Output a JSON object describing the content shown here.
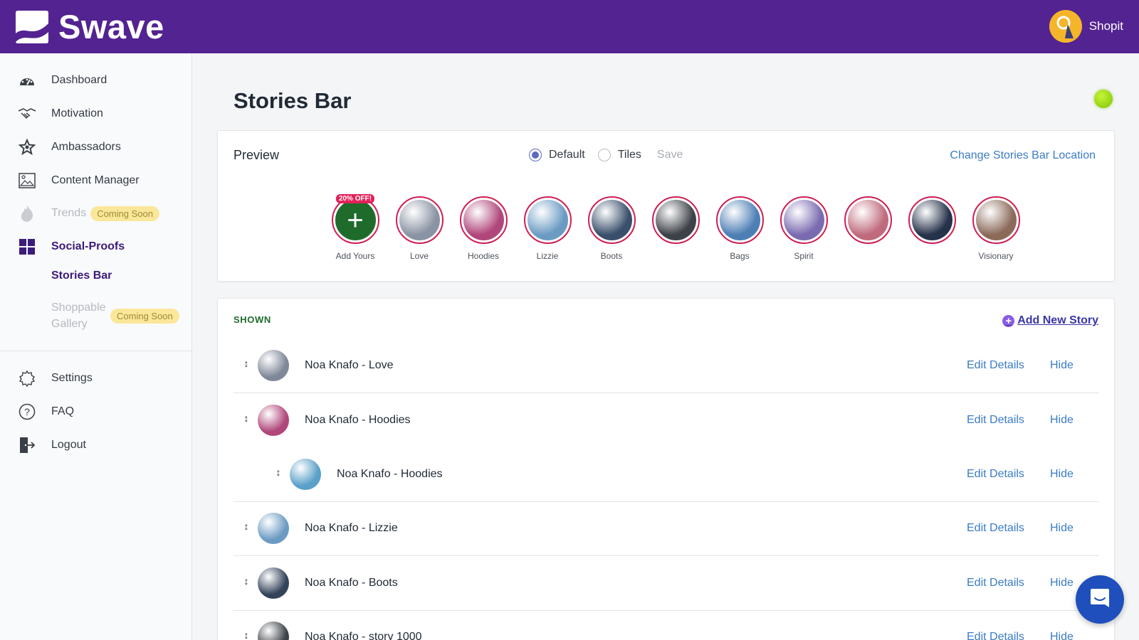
{
  "app": {
    "name": "Swave"
  },
  "user": {
    "name": "Shopit"
  },
  "sidebar": {
    "items": [
      {
        "label": "Dashboard"
      },
      {
        "label": "Motivation"
      },
      {
        "label": "Ambassadors"
      },
      {
        "label": "Content Manager"
      },
      {
        "label": "Trends",
        "badge": "Coming Soon"
      },
      {
        "label": "Social-Proofs"
      }
    ],
    "sub_items": [
      {
        "label": "Stories Bar"
      },
      {
        "label": "Shoppable Gallery",
        "badge": "Coming Soon"
      }
    ],
    "bottom_items": [
      {
        "label": "Settings"
      },
      {
        "label": "FAQ"
      },
      {
        "label": "Logout"
      }
    ]
  },
  "page": {
    "title": "Stories Bar"
  },
  "preview": {
    "title": "Preview",
    "options": [
      "Default",
      "Tiles"
    ],
    "selected": "Default",
    "save_label": "Save",
    "location_link": "Change Stories Bar Location",
    "promo": "20% OFF!",
    "stories": [
      {
        "label": "Add Yours"
      },
      {
        "label": "Love",
        "color": "#8a93a3"
      },
      {
        "label": "Hoodies",
        "color": "#b0467a"
      },
      {
        "label": "Lizzie",
        "color": "#6b9bc3"
      },
      {
        "label": "Boots",
        "color": "#3a4f6b"
      },
      {
        "label": "",
        "color": "#3d4248"
      },
      {
        "label": "Bags",
        "color": "#4d7fb5"
      },
      {
        "label": "Spirit",
        "color": "#7a6bb0"
      },
      {
        "label": "",
        "color": "#c06b7d"
      },
      {
        "label": "",
        "color": "#26324a"
      },
      {
        "label": "Visionary",
        "color": "#8b6a5a"
      }
    ]
  },
  "shown": {
    "title": "SHOWN",
    "add_label": "Add New Story",
    "edit_label": "Edit Details",
    "hide_label": "Hide",
    "rows": [
      {
        "title": "Noa Knafo - Love",
        "color": "#7f8898"
      },
      {
        "title": "Noa Knafo - Hoodies",
        "color": "#b0467a"
      },
      {
        "title": "Noa Knafo - Hoodies",
        "color": "#5aa0c8"
      },
      {
        "title": "Noa Knafo - Lizzie",
        "color": "#6b9bc3"
      },
      {
        "title": "Noa Knafo - Boots",
        "color": "#34435a"
      },
      {
        "title": "Noa Knafo - story 1000",
        "color": "#3d4248"
      }
    ]
  }
}
